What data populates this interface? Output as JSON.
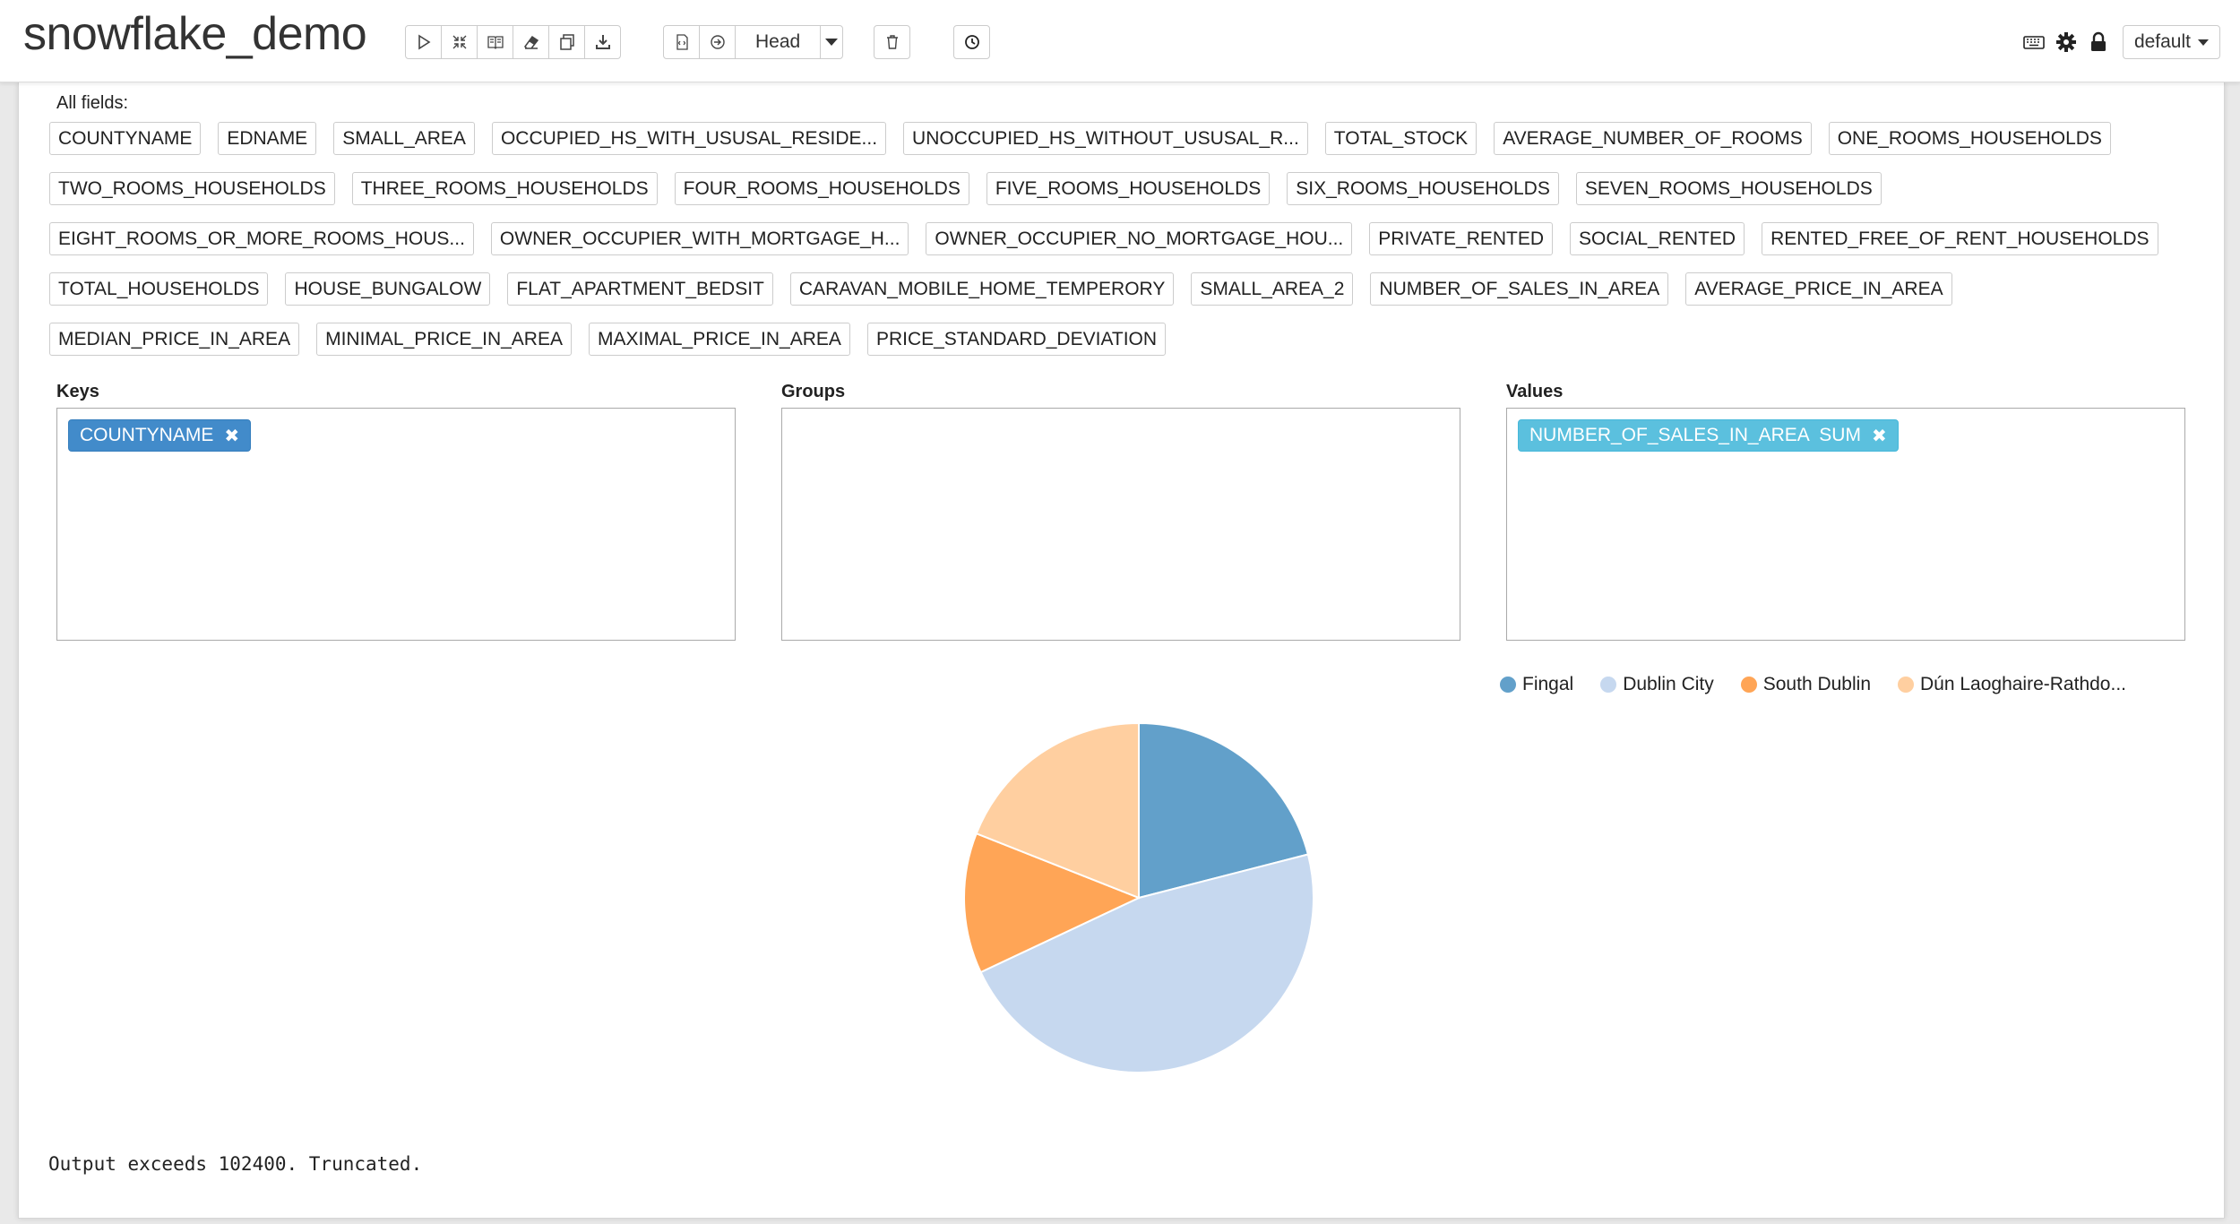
{
  "header": {
    "title": "snowflake_demo",
    "branch_label": "Head",
    "kernel_label": "default"
  },
  "toolbar": {
    "group1_icons": [
      "run-icon",
      "collapse-icon",
      "book-icon",
      "eraser-icon",
      "copy-icon",
      "download-icon"
    ],
    "group2_icons": [
      "code-icon",
      "arrow-right-icon"
    ],
    "clear_icon": "trash-icon",
    "history_icon": "clock-icon",
    "right_icons": [
      "keyboard-icon",
      "gear-icon",
      "lock-icon"
    ]
  },
  "all_fields_label": "All fields:",
  "fields": [
    "COUNTYNAME",
    "EDNAME",
    "SMALL_AREA",
    "OCCUPIED_HS_WITH_USUSAL_RESIDE...",
    "UNOCCUPIED_HS_WITHOUT_USUSAL_R...",
    "TOTAL_STOCK",
    "AVERAGE_NUMBER_OF_ROOMS",
    "ONE_ROOMS_HOUSEHOLDS",
    "TWO_ROOMS_HOUSEHOLDS",
    "THREE_ROOMS_HOUSEHOLDS",
    "FOUR_ROOMS_HOUSEHOLDS",
    "FIVE_ROOMS_HOUSEHOLDS",
    "SIX_ROOMS_HOUSEHOLDS",
    "SEVEN_ROOMS_HOUSEHOLDS",
    "EIGHT_ROOMS_OR_MORE_ROOMS_HOUS...",
    "OWNER_OCCUPIER_WITH_MORTGAGE_H...",
    "OWNER_OCCUPIER_NO_MORTGAGE_HOU...",
    "PRIVATE_RENTED",
    "SOCIAL_RENTED",
    "RENTED_FREE_OF_RENT_HOUSEHOLDS",
    "TOTAL_HOUSEHOLDS",
    "HOUSE_BUNGALOW",
    "FLAT_APARTMENT_BEDSIT",
    "CARAVAN_MOBILE_HOME_TEMPERORY",
    "SMALL_AREA_2",
    "NUMBER_OF_SALES_IN_AREA",
    "AVERAGE_PRICE_IN_AREA",
    "MEDIAN_PRICE_IN_AREA",
    "MINIMAL_PRICE_IN_AREA",
    "MAXIMAL_PRICE_IN_AREA",
    "PRICE_STANDARD_DEVIATION"
  ],
  "keys": {
    "label": "Keys",
    "tag": "COUNTYNAME"
  },
  "groups": {
    "label": "Groups"
  },
  "values": {
    "label": "Values",
    "tag": "NUMBER_OF_SALES_IN_AREA  SUM"
  },
  "remove_glyph": "✖",
  "chart_data": {
    "type": "pie",
    "title": "",
    "legend_position": "top-right",
    "slices": [
      {
        "label": "Fingal",
        "value": 21,
        "color": "#1f77b4"
      },
      {
        "label": "Dublin City",
        "value": 47,
        "color": "#aec7e8"
      },
      {
        "label": "South Dublin",
        "value": 13,
        "color": "#ff7f0e"
      },
      {
        "label": "Dún Laoghaire-Rathdo...",
        "value": 19,
        "color": "#ffbb78"
      }
    ]
  },
  "output_note": "Output exceeds 102400. Truncated."
}
